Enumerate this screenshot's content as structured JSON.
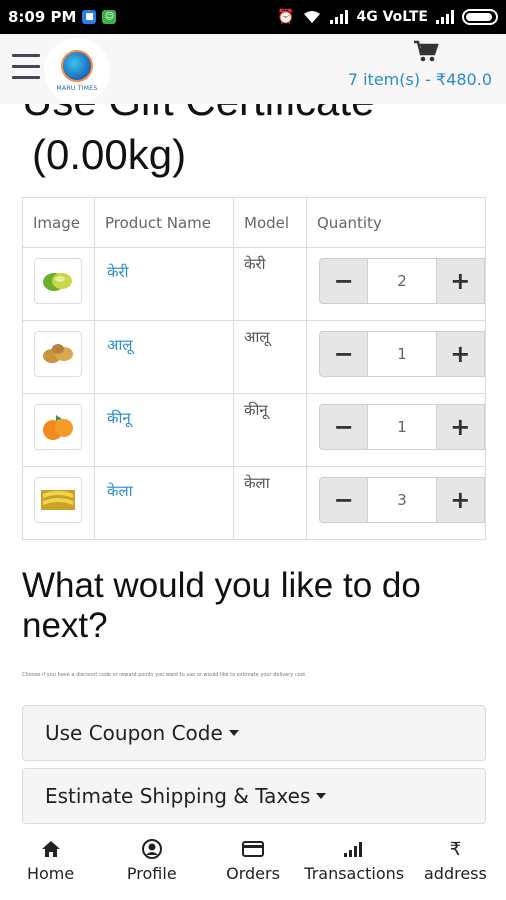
{
  "status_bar": {
    "time": "8:09 PM",
    "network": "4G VoLTE"
  },
  "header": {
    "logo_text": "MARU TIMES",
    "cart_summary": "7 item(s) - ₹480.0"
  },
  "page": {
    "title": "Use Gift Certificate",
    "weight": "(0.00kg)"
  },
  "cart_table": {
    "headers": [
      "Image",
      "Product Name",
      "Model",
      "Quantity"
    ],
    "rows": [
      {
        "name": "केरी",
        "model": "केरी",
        "quantity": "2",
        "image_icon": "mango-icon"
      },
      {
        "name": "आलू",
        "model": "आलू",
        "quantity": "1",
        "image_icon": "potato-icon"
      },
      {
        "name": "कीनू",
        "model": "कीनू",
        "quantity": "1",
        "image_icon": "orange-icon"
      },
      {
        "name": "केला",
        "model": "केला",
        "quantity": "3",
        "image_icon": "banana-icon"
      }
    ],
    "minus_label": "−",
    "plus_label": "+"
  },
  "next_section": {
    "title": "What would you like to do next?",
    "hint": "Choose if you have a discount code or reward points you want to use or would like to estimate your delivery cost.",
    "coupon_label": "Use Coupon Code",
    "shipping_label": "Estimate Shipping & Taxes"
  },
  "bottom_nav": {
    "items": [
      {
        "label": "Home",
        "icon": "home-icon"
      },
      {
        "label": "Profile",
        "icon": "profile-icon"
      },
      {
        "label": "Orders",
        "icon": "credit-card-icon"
      },
      {
        "label": "Transactions",
        "icon": "signal-bars-icon"
      },
      {
        "label": "address",
        "icon": "rupee-icon"
      }
    ],
    "rupee_symbol": "₹"
  },
  "colors": {
    "link": "#2a8bd0",
    "header_bg": "#f7f7f7",
    "status_bg": "#000000"
  }
}
